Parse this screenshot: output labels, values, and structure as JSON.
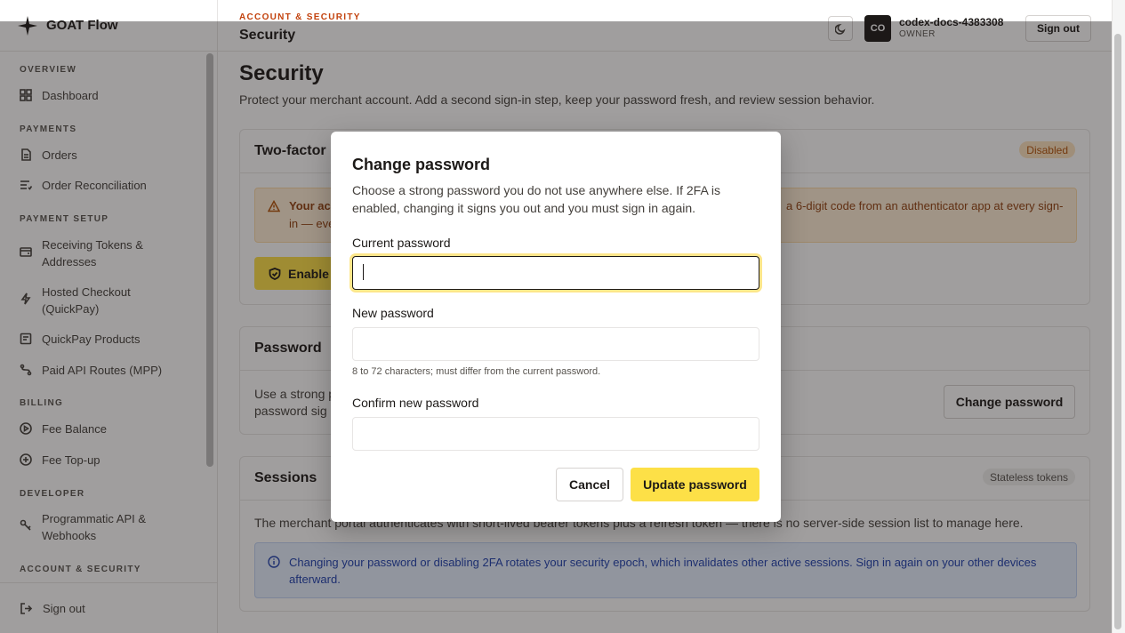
{
  "brand": {
    "name": "GOAT Flow"
  },
  "sidebar": {
    "sections": {
      "overview": "OVERVIEW",
      "payments": "PAYMENTS",
      "payment_setup": "PAYMENT SETUP",
      "billing": "BILLING",
      "developer": "DEVELOPER",
      "account_security": "ACCOUNT & SECURITY"
    },
    "items": {
      "dashboard": "Dashboard",
      "orders": "Orders",
      "order_reconciliation": "Order Reconciliation",
      "receiving_tokens_1": "Receiving Tokens &",
      "receiving_tokens_2": "Addresses",
      "hosted_checkout_1": "Hosted Checkout",
      "hosted_checkout_2": "(QuickPay)",
      "quickpay_products": "QuickPay Products",
      "paid_api_routes": "Paid API Routes (MPP)",
      "fee_balance": "Fee Balance",
      "fee_topup": "Fee Top-up",
      "programmatic_api_1": "Programmatic API &",
      "programmatic_api_2": "Webhooks"
    },
    "sign_out": "Sign out"
  },
  "header": {
    "eyebrow": "ACCOUNT & SECURITY",
    "title": "Security",
    "avatar_initials": "CO",
    "user_name": "codex-docs-4383308",
    "user_role": "OWNER",
    "sign_out": "Sign out"
  },
  "main": {
    "title": "Security",
    "description": "Protect your merchant account. Add a second sign-in step, keep your password fresh, and review session behavior.",
    "two_factor": {
      "title": "Two-factor",
      "badge": "Disabled",
      "warning_bold": "Your ac",
      "warning_line2": "in — eve",
      "warning_right": "a 6-digit code from an authenticator app at every sign-",
      "enable_label": "Enable"
    },
    "password": {
      "title": "Password",
      "text_line1": "Use a strong p",
      "text_line2": "password sig",
      "change_label": "Change password"
    },
    "sessions": {
      "title": "Sessions",
      "badge": "Stateless tokens",
      "text": "The merchant portal authenticates with short-lived bearer tokens plus a refresh token — there is no server-side session list to manage here.",
      "info": "Changing your password or disabling 2FA rotates your security epoch, which invalidates other active sessions. Sign in again on your other devices afterward."
    }
  },
  "modal": {
    "title": "Change password",
    "description": "Choose a strong password you do not use anywhere else. If 2FA is enabled, changing it signs you out and you must sign in again.",
    "current_label": "Current password",
    "current_value": "",
    "new_label": "New password",
    "new_value": "",
    "new_hint": "8 to 72 characters; must differ from the current password.",
    "confirm_label": "Confirm new password",
    "confirm_value": "",
    "cancel_label": "Cancel",
    "update_label": "Update password"
  },
  "colors": {
    "accent": "#fde047",
    "eyebrow": "#c2410c",
    "warning_bg": "#ffeed6",
    "info_bg": "#e6efff"
  }
}
